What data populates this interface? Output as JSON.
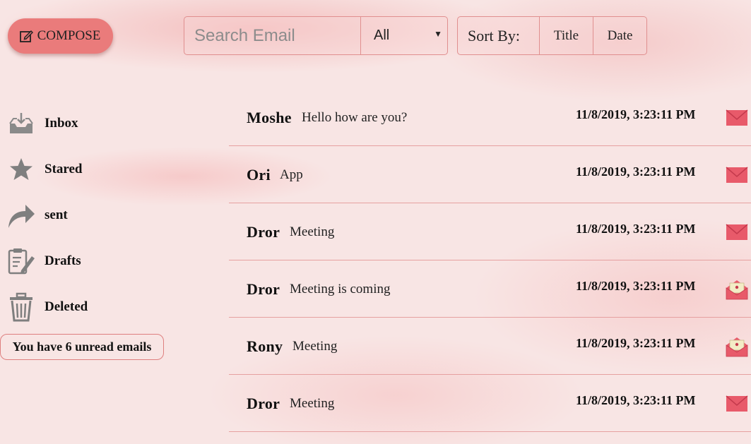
{
  "header": {
    "compose_label": "COMPOSE",
    "search_placeholder": "Search Email",
    "filter_value": "All",
    "sort_label": "Sort By:",
    "sort_title": "Title",
    "sort_date": "Date"
  },
  "sidebar": {
    "items": [
      {
        "label": "Inbox",
        "icon": "inbox-icon"
      },
      {
        "label": "Stared",
        "icon": "star-icon"
      },
      {
        "label": "sent",
        "icon": "share-arrow-icon"
      },
      {
        "label": "Drafts",
        "icon": "clipboard-pencil-icon"
      },
      {
        "label": "Deleted",
        "icon": "trash-icon"
      }
    ],
    "unread_text": "You have 6 unread emails"
  },
  "emails": [
    {
      "sender": "Moshe",
      "subject": "Hello how are you?",
      "date": "11/8/2019, 3:23:11 PM",
      "status_icon": "closed-envelope-icon"
    },
    {
      "sender": "Ori",
      "subject": "App",
      "date": "11/8/2019, 3:23:11 PM",
      "status_icon": "closed-envelope-icon"
    },
    {
      "sender": "Dror",
      "subject": "Meeting",
      "date": "11/8/2019, 3:23:11 PM",
      "status_icon": "closed-envelope-icon"
    },
    {
      "sender": "Dror",
      "subject": "Meeting is coming",
      "date": "11/8/2019, 3:23:11 PM",
      "status_icon": "open-envelope-icon"
    },
    {
      "sender": "Rony",
      "subject": "Meeting",
      "date": "11/8/2019, 3:23:11 PM",
      "status_icon": "open-envelope-icon"
    },
    {
      "sender": "Dror",
      "subject": "Meeting",
      "date": "11/8/2019, 3:23:11 PM",
      "status_icon": "closed-envelope-icon"
    }
  ],
  "colors": {
    "accent": "#ea7b7b",
    "border": "#e08f8f",
    "envelope": "#e85a6a",
    "letter": "#f3ecc6"
  }
}
